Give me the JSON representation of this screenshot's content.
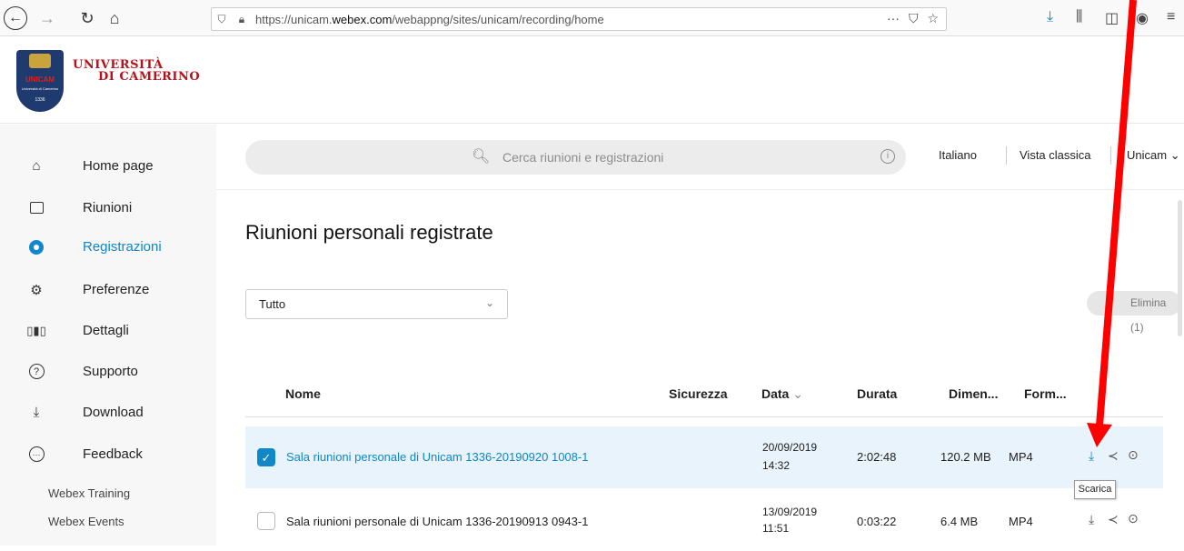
{
  "browser": {
    "url_prefix": "https://unicam.",
    "url_host": "webex.com",
    "url_path": "/webappng/sites/unicam/recording/home",
    "icons": [
      "back-icon",
      "forward-icon",
      "reload-icon",
      "home-icon",
      "shield-icon",
      "lock-icon",
      "more-icon",
      "pocket-icon",
      "star-icon",
      "download-icon",
      "library-icon",
      "sidebar-icon",
      "account-icon",
      "menu-icon"
    ]
  },
  "logo": {
    "badge_text": "UNICAM",
    "badge_small": "Università di Camerino",
    "badge_year": "1336",
    "name_line1": "UNIVERSITÀ",
    "name_line2": "DI CAMERINO"
  },
  "sidebar": {
    "items": [
      {
        "label": "Home page",
        "icon": "home-icon"
      },
      {
        "label": "Riunioni",
        "icon": "calendar-icon"
      },
      {
        "label": "Registrazioni",
        "icon": "recording-icon",
        "active": true
      },
      {
        "label": "Preferenze",
        "icon": "gear-icon"
      },
      {
        "label": "Dettagli",
        "icon": "bar-chart-icon"
      },
      {
        "label": "Supporto",
        "icon": "help-icon"
      },
      {
        "label": "Download",
        "icon": "download-icon"
      },
      {
        "label": "Feedback",
        "icon": "chat-icon"
      }
    ],
    "sub_items": [
      "Webex Training",
      "Webex Events"
    ]
  },
  "search": {
    "placeholder": "Cerca riunioni e registrazioni"
  },
  "header_links": {
    "language": "Italiano",
    "classic_view": "Vista classica",
    "user": "Unicam"
  },
  "main": {
    "title": "Riunioni personali registrate",
    "filter_value": "Tutto",
    "delete_label": "Elimina (1)"
  },
  "table": {
    "columns": [
      "Nome",
      "Sicurezza",
      "Data",
      "Durata",
      "Dimen...",
      "Form..."
    ],
    "rows": [
      {
        "name": "Sala riunioni personale di Unicam 1336-20190920 1008-1",
        "date": "20/09/2019",
        "time": "14:32",
        "duration": "2:02:48",
        "size": "120.2 MB",
        "format": "MP4",
        "selected": true
      },
      {
        "name": "Sala riunioni personale di Unicam 1336-20190913 0943-1",
        "date": "13/09/2019",
        "time": "11:51",
        "duration": "0:03:22",
        "size": "6.4 MB",
        "format": "MP4",
        "selected": false
      }
    ]
  },
  "tooltip": "Scarica",
  "colors": {
    "accent": "#0f87c8",
    "brand_red": "#b5121b",
    "annotation": "#ff0000"
  }
}
